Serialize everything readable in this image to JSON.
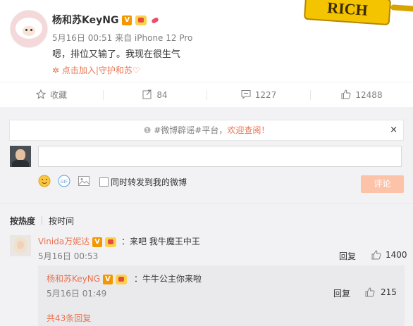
{
  "post": {
    "author": "杨和苏KeyNG",
    "time": "5月16日 00:51 来自 iPhone 12 Pro",
    "text": "嗯，排位又输了。我现在很生气",
    "join_link": "点击加入|守护和苏♡",
    "badge_text": "RICH"
  },
  "actions": {
    "favorite": "收藏",
    "repost": "84",
    "comment": "1227",
    "like": "12488"
  },
  "notice": {
    "hashtag": "#微博辟谣#平台，",
    "link": "欢迎查阅！",
    "close": "×"
  },
  "composer": {
    "sync_label": "同时转发到我的微博",
    "submit_label": "评论"
  },
  "sort": {
    "hot": "按热度",
    "time": "按时间"
  },
  "comment1": {
    "name": "Vinida万妮达",
    "text": "：来吧 我牛魔王中王",
    "time": "5月16日 00:53",
    "reply": "回复",
    "likes": "1400"
  },
  "subcomment1": {
    "name": "杨和苏KeyNG",
    "text": "：牛牛公主你来啦",
    "time": "5月16日 01:49",
    "reply": "回复",
    "likes": "215"
  },
  "more_replies": "共43条回复",
  "colors": {
    "accent": "#eb7350",
    "submit_disabled": "#fcc3a8",
    "vip_badge": "#f39800"
  }
}
